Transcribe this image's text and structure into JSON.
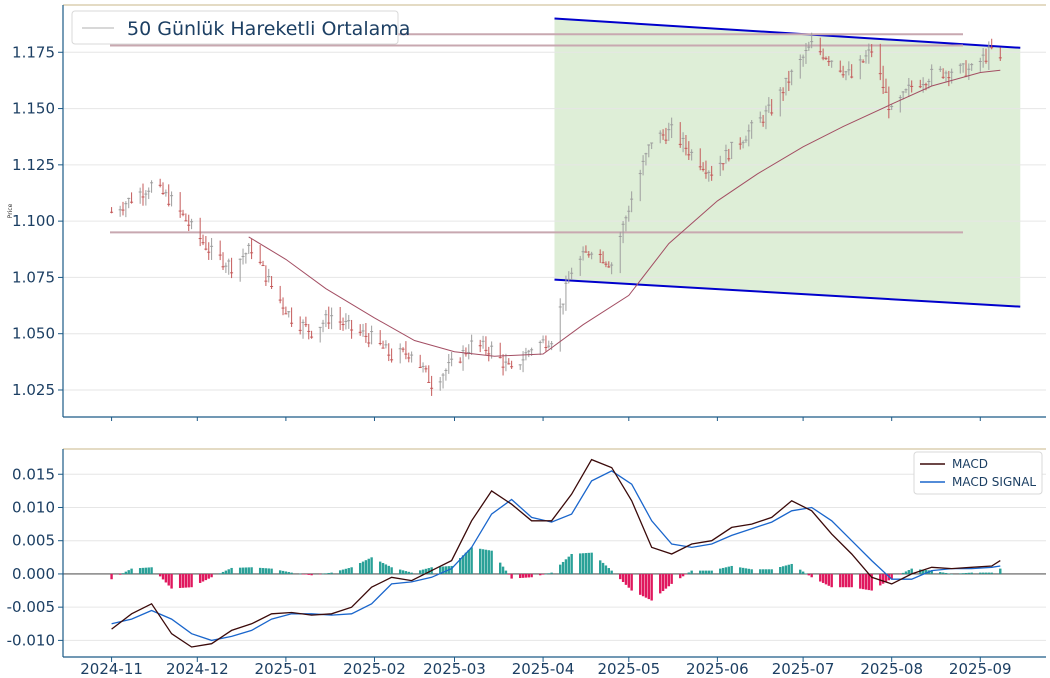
{
  "colors": {
    "axis": "#1c5a87",
    "top_border": "#c8b78a",
    "grid": "#e6e6e6",
    "candle": "#9e9e9e",
    "candle_red": "#c45a5a",
    "ma_line": "#a34e63",
    "hline": "#c8a8b0",
    "channel": "#0000cc",
    "channel_fill": "#c8e3bd",
    "macd": "#3b0a0a",
    "signal": "#1a66cc",
    "hist_pos": "#2aa198",
    "hist_neg": "#e0185e"
  },
  "chart_data": [
    {
      "type": "line",
      "ylabel": "Price",
      "ylim": [
        1.013,
        1.196
      ],
      "yticks": [
        "1.025",
        "1.050",
        "1.075",
        "1.100",
        "1.125",
        "1.150",
        "1.175"
      ],
      "grid": true,
      "legend": {
        "position": "top-left",
        "entries": [
          "50 Günlük Hareketli Ortalama"
        ]
      },
      "series": [
        {
          "name": "50 Günlük Hareketli Ortalama",
          "x": [
            "2024-12-19",
            "2025-01-01",
            "2025-01-15",
            "2025-02-01",
            "2025-02-15",
            "2025-03-01",
            "2025-03-15",
            "2025-04-01",
            "2025-04-15",
            "2025-05-01",
            "2025-05-15",
            "2025-06-01",
            "2025-06-15",
            "2025-07-01",
            "2025-07-15",
            "2025-08-01",
            "2025-08-15",
            "2025-09-01",
            "2025-09-08"
          ],
          "y": [
            1.093,
            1.083,
            1.07,
            1.057,
            1.047,
            1.042,
            1.04,
            1.041,
            1.054,
            1.067,
            1.09,
            1.109,
            1.121,
            1.133,
            1.142,
            1.152,
            1.16,
            1.166,
            1.167
          ]
        }
      ],
      "price_path": {
        "x": [
          "2024-11-01",
          "2024-11-08",
          "2024-11-15",
          "2024-11-22",
          "2024-11-29",
          "2024-12-06",
          "2024-12-13",
          "2024-12-20",
          "2024-12-27",
          "2025-01-03",
          "2025-01-10",
          "2025-01-17",
          "2025-01-24",
          "2025-01-31",
          "2025-02-07",
          "2025-02-14",
          "2025-02-21",
          "2025-02-28",
          "2025-03-07",
          "2025-03-14",
          "2025-03-21",
          "2025-03-28",
          "2025-04-04",
          "2025-04-11",
          "2025-04-18",
          "2025-04-25",
          "2025-05-02",
          "2025-05-09",
          "2025-05-16",
          "2025-05-23",
          "2025-05-30",
          "2025-06-06",
          "2025-06-13",
          "2025-06-20",
          "2025-06-27",
          "2025-07-04",
          "2025-07-11",
          "2025-07-18",
          "2025-07-25",
          "2025-08-01",
          "2025-08-08",
          "2025-08-15",
          "2025-08-22",
          "2025-08-29",
          "2025-09-05",
          "2025-09-08"
        ],
        "y": [
          1.104,
          1.11,
          1.116,
          1.109,
          1.097,
          1.086,
          1.08,
          1.088,
          1.071,
          1.057,
          1.051,
          1.058,
          1.052,
          1.048,
          1.04,
          1.042,
          1.028,
          1.036,
          1.045,
          1.043,
          1.033,
          1.044,
          1.048,
          1.078,
          1.088,
          1.081,
          1.11,
          1.136,
          1.14,
          1.13,
          1.122,
          1.132,
          1.141,
          1.15,
          1.165,
          1.178,
          1.172,
          1.164,
          1.176,
          1.148,
          1.16,
          1.165,
          1.167,
          1.167,
          1.176,
          1.171
        ]
      },
      "horizontal_lines": [
        1.183,
        1.178,
        1.095
      ],
      "channel": {
        "start": "2025-04-05",
        "end": "2025-09-15",
        "upper": [
          1.19,
          1.177
        ],
        "lower": [
          1.074,
          1.062
        ]
      }
    },
    {
      "type": "line",
      "ylim": [
        -0.0125,
        0.0188
      ],
      "yticks": [
        "-0.010",
        "-0.005",
        "0.000",
        "0.005",
        "0.010",
        "0.015"
      ],
      "xticks": [
        "2024-11",
        "2024-12",
        "2025-01",
        "2025-02",
        "2025-03",
        "2025-04",
        "2025-05",
        "2025-06",
        "2025-07",
        "2025-08",
        "2025-09"
      ],
      "grid": true,
      "legend": {
        "position": "top-right",
        "entries": [
          "MACD",
          "MACD SIGNAL"
        ]
      },
      "series": [
        {
          "name": "MACD",
          "x": [
            "2024-11-01",
            "2024-11-08",
            "2024-11-15",
            "2024-11-22",
            "2024-11-29",
            "2024-12-06",
            "2024-12-13",
            "2024-12-20",
            "2024-12-27",
            "2025-01-03",
            "2025-01-10",
            "2025-01-17",
            "2025-01-24",
            "2025-01-31",
            "2025-02-07",
            "2025-02-14",
            "2025-02-21",
            "2025-02-28",
            "2025-03-07",
            "2025-03-14",
            "2025-03-21",
            "2025-03-28",
            "2025-04-04",
            "2025-04-11",
            "2025-04-18",
            "2025-04-25",
            "2025-05-02",
            "2025-05-09",
            "2025-05-16",
            "2025-05-23",
            "2025-05-30",
            "2025-06-06",
            "2025-06-13",
            "2025-06-20",
            "2025-06-27",
            "2025-07-04",
            "2025-07-11",
            "2025-07-18",
            "2025-07-25",
            "2025-08-01",
            "2025-08-08",
            "2025-08-15",
            "2025-08-22",
            "2025-08-29",
            "2025-09-05",
            "2025-09-08"
          ],
          "y": [
            -0.0083,
            -0.006,
            -0.0045,
            -0.009,
            -0.011,
            -0.0105,
            -0.0085,
            -0.0075,
            -0.006,
            -0.0058,
            -0.0062,
            -0.006,
            -0.005,
            -0.002,
            -0.0005,
            -0.001,
            0.0005,
            0.002,
            0.008,
            0.0125,
            0.0105,
            0.008,
            0.008,
            0.012,
            0.0172,
            0.016,
            0.011,
            0.004,
            0.003,
            0.0045,
            0.005,
            0.007,
            0.0075,
            0.0085,
            0.011,
            0.0095,
            0.006,
            0.003,
            -0.0005,
            -0.0015,
            0.0,
            0.001,
            0.0008,
            0.001,
            0.0012,
            0.002
          ]
        },
        {
          "name": "MACD SIGNAL",
          "x": [
            "2024-11-01",
            "2024-11-08",
            "2024-11-15",
            "2024-11-22",
            "2024-11-29",
            "2024-12-06",
            "2024-12-13",
            "2024-12-20",
            "2024-12-27",
            "2025-01-03",
            "2025-01-10",
            "2025-01-17",
            "2025-01-24",
            "2025-01-31",
            "2025-02-07",
            "2025-02-14",
            "2025-02-21",
            "2025-02-28",
            "2025-03-07",
            "2025-03-14",
            "2025-03-21",
            "2025-03-28",
            "2025-04-04",
            "2025-04-11",
            "2025-04-18",
            "2025-04-25",
            "2025-05-02",
            "2025-05-09",
            "2025-05-16",
            "2025-05-23",
            "2025-05-30",
            "2025-06-06",
            "2025-06-13",
            "2025-06-20",
            "2025-06-27",
            "2025-07-04",
            "2025-07-11",
            "2025-07-18",
            "2025-07-25",
            "2025-08-01",
            "2025-08-08",
            "2025-08-15",
            "2025-08-22",
            "2025-08-29",
            "2025-09-05",
            "2025-09-08"
          ],
          "y": [
            -0.0075,
            -0.0068,
            -0.0055,
            -0.0068,
            -0.009,
            -0.01,
            -0.0094,
            -0.0085,
            -0.0068,
            -0.006,
            -0.006,
            -0.0062,
            -0.006,
            -0.0045,
            -0.0015,
            -0.0012,
            -0.0005,
            0.0008,
            0.004,
            0.009,
            0.0112,
            0.0085,
            0.0078,
            0.009,
            0.014,
            0.0155,
            0.0135,
            0.008,
            0.0045,
            0.004,
            0.0045,
            0.0058,
            0.0068,
            0.0078,
            0.0095,
            0.01,
            0.008,
            0.005,
            0.002,
            -0.0008,
            -0.0008,
            0.0005,
            0.0008,
            0.0008,
            0.001,
            0.0012
          ]
        }
      ]
    }
  ]
}
